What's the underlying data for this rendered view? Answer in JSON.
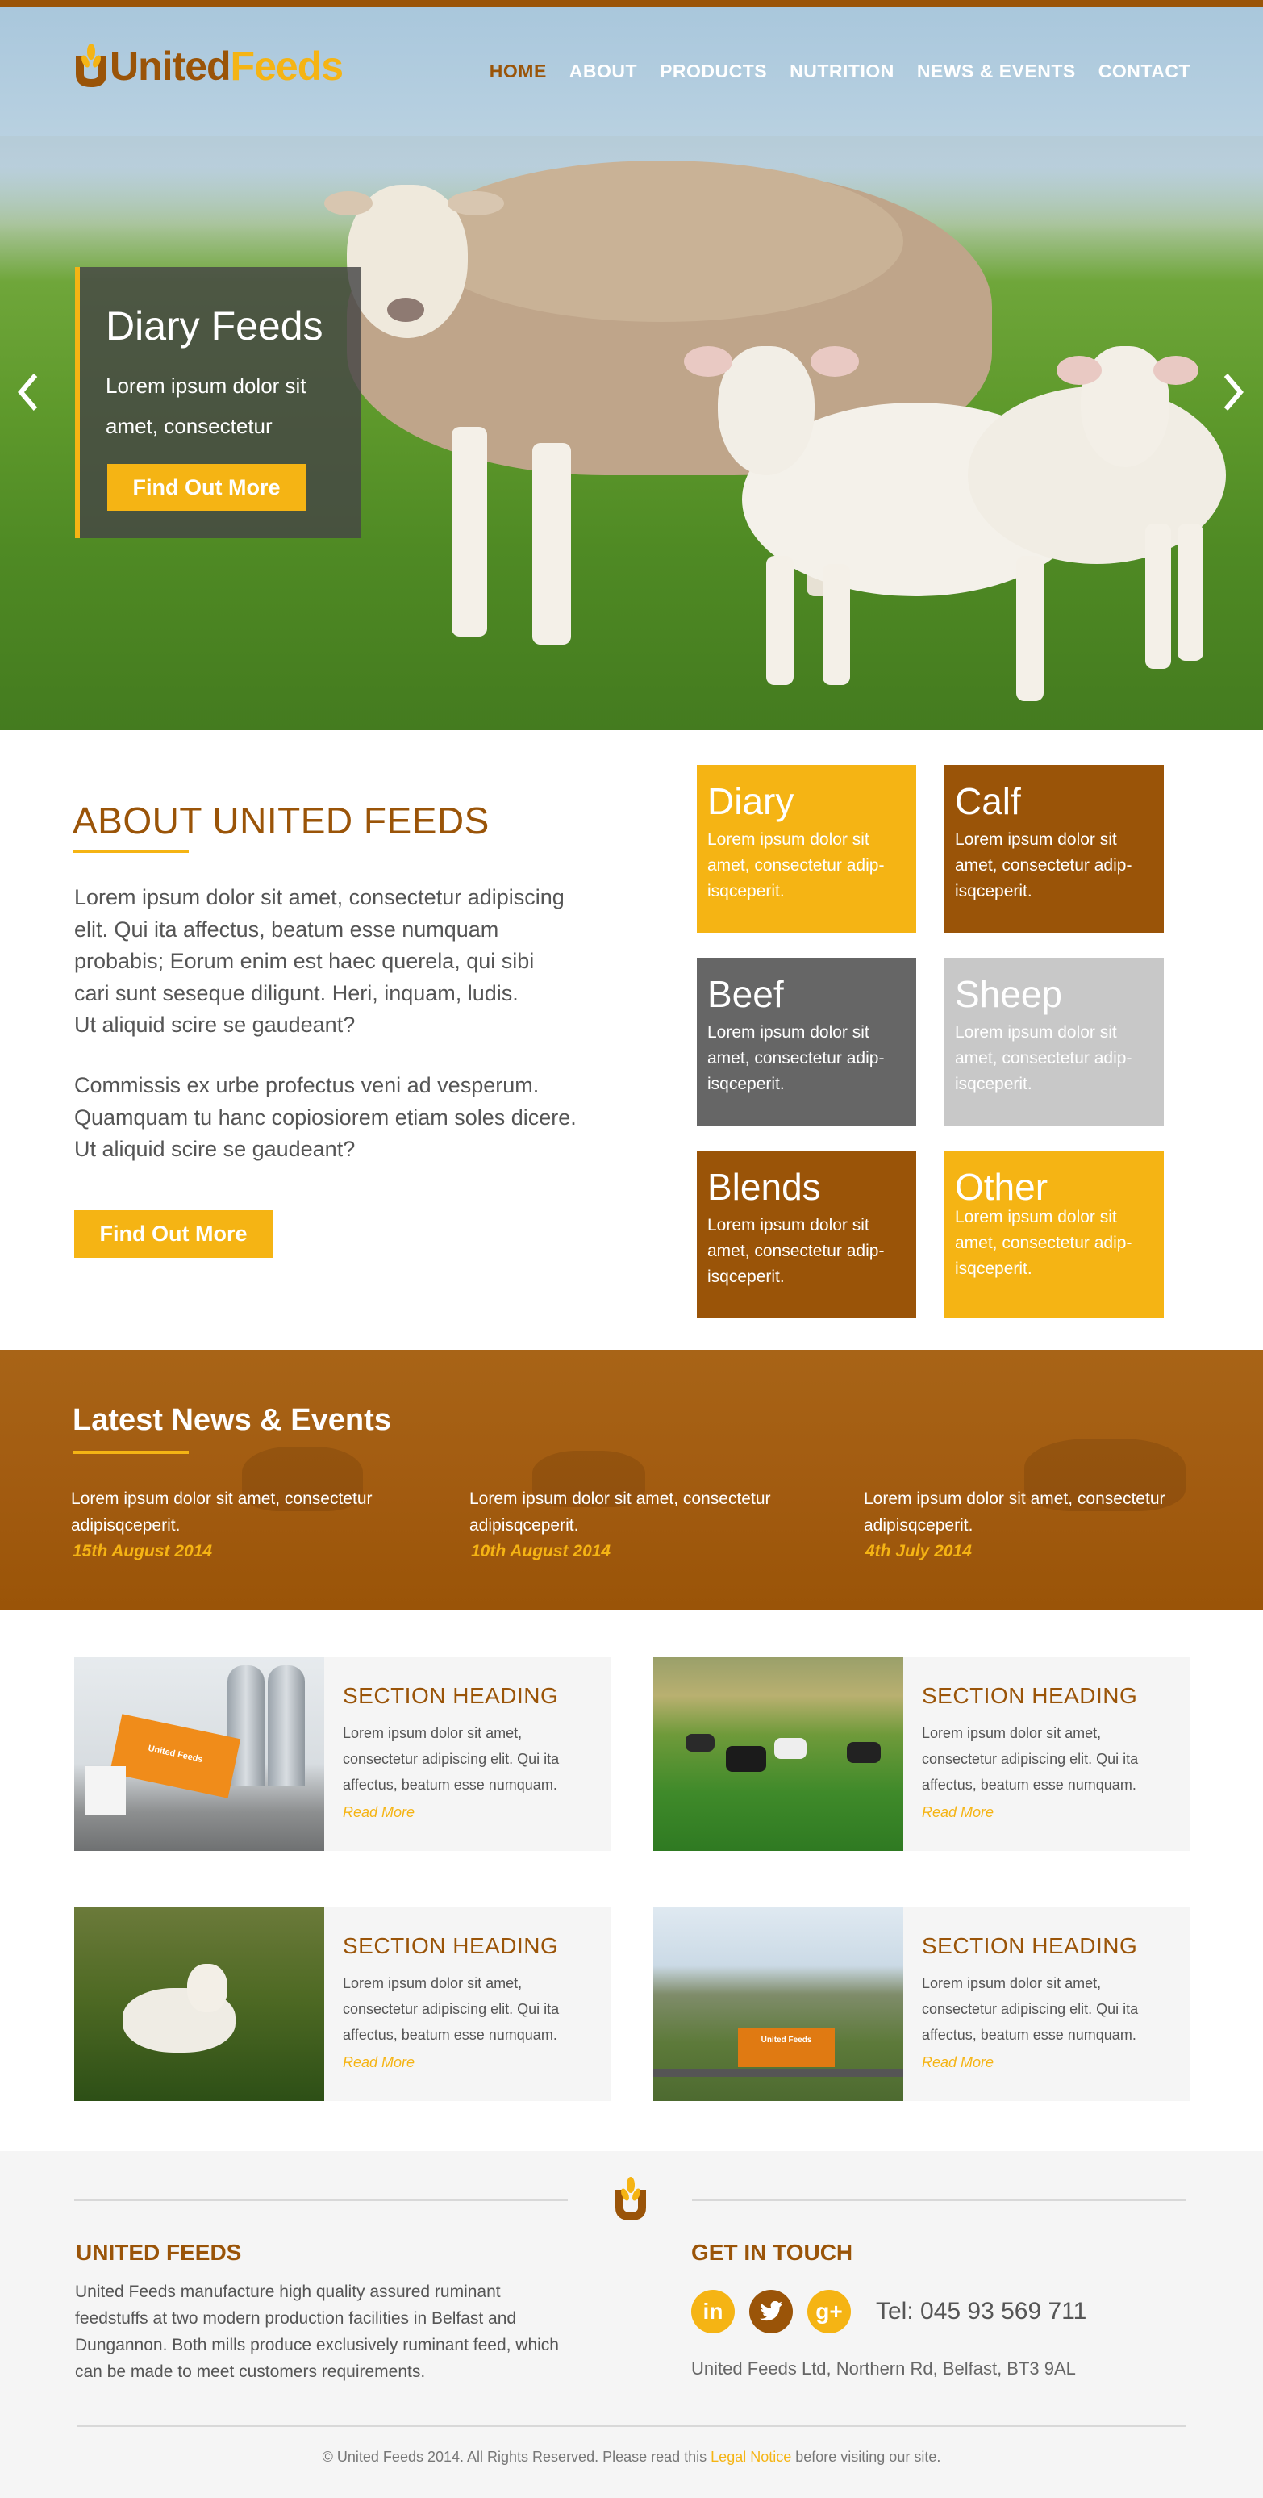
{
  "brand": {
    "part1": "United",
    "part2": "Feeds"
  },
  "nav": {
    "items": [
      "HOME",
      "ABOUT",
      "PRODUCTS",
      "NUTRITION",
      "NEWS & EVENTS",
      "CONTACT"
    ],
    "active": "HOME"
  },
  "hero": {
    "title": "Diary Feeds",
    "text": "Lorem ipsum dolor sit amet, consectetur",
    "button": "Find Out More"
  },
  "about": {
    "title": "ABOUT UNITED FEEDS",
    "para1": "Lorem ipsum dolor sit amet, consectetur adipiscing\nelit. Qui ita affectus, beatum esse numquam\nprobabis; Eorum enim est haec querela, qui sibi\ncari sunt seseque diligunt. Heri, inquam, ludis.\nUt aliquid scire se gaudeant?",
    "para2": "Commissis ex urbe profectus veni ad vesperum.\nQuamquam tu hanc copiosiorem etiam soles dicere.\nUt aliquid scire se gaudeant?",
    "button": "Find Out More"
  },
  "tiles": [
    {
      "title": "Diary",
      "text": "Lorem ipsum dolor sit amet, consectetur adip-isqceperit.",
      "color": "#f5b414"
    },
    {
      "title": "Calf",
      "text": "Lorem ipsum dolor sit amet, consectetur adip-isqceperit.",
      "color": "#9a5408"
    },
    {
      "title": "Beef",
      "text": "Lorem ipsum dolor sit amet, consectetur adip-isqceperit.",
      "color": "#666666"
    },
    {
      "title": "Sheep",
      "text": "Lorem ipsum dolor sit amet, consectetur adip-isqceperit.",
      "color": "#c8c8c8"
    },
    {
      "title": "Blends",
      "text": "Lorem ipsum dolor sit amet, consectetur adip-isqceperit.",
      "color": "#9a5408"
    },
    {
      "title": "Other",
      "text": "Lorem ipsum dolor sit amet, consectetur adip-isqceperit.",
      "color": "#f5b414"
    }
  ],
  "news": {
    "title": "Latest News & Events",
    "items": [
      {
        "text": "Lorem ipsum dolor sit amet, consectetur adipisqceperit.",
        "date": "15th August 2014"
      },
      {
        "text": "Lorem ipsum dolor sit amet, consectetur adipisqceperit.",
        "date": "10th August 2014"
      },
      {
        "text": "Lorem ipsum dolor sit amet, consectetur adipisqceperit.",
        "date": "4th July 2014"
      }
    ]
  },
  "cards": [
    {
      "heading": "SECTION HEADING",
      "text": "Lorem ipsum dolor sit amet, consectetur adipiscing elit. Qui ita affectus, beatum esse numquam.",
      "link": "Read More",
      "truck_label": "United Feeds"
    },
    {
      "heading": "SECTION HEADING",
      "text": "Lorem ipsum dolor sit amet, consectetur adipiscing elit. Qui ita affectus, beatum esse numquam.",
      "link": "Read More"
    },
    {
      "heading": "SECTION HEADING",
      "text": "Lorem ipsum dolor sit amet, consectetur adipiscing elit. Qui ita affectus, beatum esse numquam.",
      "link": "Read More"
    },
    {
      "heading": "SECTION HEADING",
      "text": "Lorem ipsum dolor sit amet, consectetur adipiscing elit. Qui ita affectus, beatum esse numquam.",
      "link": "Read More",
      "truck_label": "United Feeds"
    }
  ],
  "footer": {
    "about_title": "UNITED FEEDS",
    "about_text": "United Feeds manufacture high quality assured ruminant feedstuffs at two modern production facilities in Belfast and Dungannon. Both mills produce exclusively ruminant feed, which can be made to meet customers requirements.",
    "contact_title": "GET IN TOUCH",
    "social": [
      {
        "icon": "linkedin-icon",
        "glyph": "in",
        "color": "#f5b414"
      },
      {
        "icon": "twitter-icon",
        "glyph": "",
        "color": "#9a5408"
      },
      {
        "icon": "google-plus-icon",
        "glyph": "g+",
        "color": "#f5b414"
      }
    ],
    "tel": "Tel: 045 93 569 711",
    "address": "United Feeds Ltd, Northern Rd, Belfast, BT3 9AL",
    "copy_pre": "© United Feeds 2014. All Rights Reserved. Please read this ",
    "copy_link": "Legal Notice",
    "copy_post": " before visiting our site."
  },
  "colors": {
    "brown": "#9a5408",
    "yellow": "#f5b414",
    "grey": "#666666",
    "light_grey": "#c8c8c8"
  }
}
